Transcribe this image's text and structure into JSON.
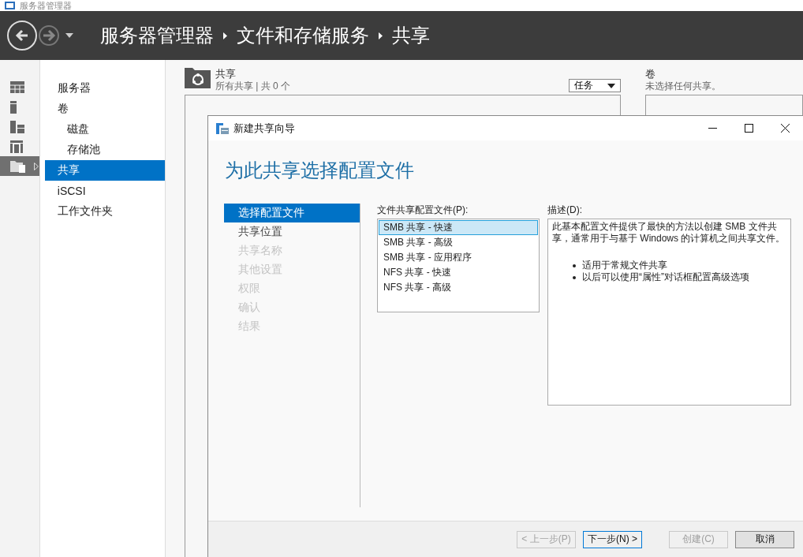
{
  "window": {
    "title": "服务器管理器"
  },
  "header": {
    "nav_buttons": [
      {
        "kind": "back",
        "disabled": false
      },
      {
        "kind": "forward",
        "disabled": true
      }
    ],
    "breadcrumb": [
      "服务器管理器",
      "文件和存储服务",
      "共享"
    ]
  },
  "rail": [
    {
      "selected": false
    },
    {
      "selected": false
    },
    {
      "selected": false
    },
    {
      "selected": false
    },
    {
      "selected": true
    }
  ],
  "sidebar": {
    "items": [
      {
        "label": "服务器",
        "selected": false
      },
      {
        "label": "卷",
        "selected": false,
        "children": [
          {
            "label": "磁盘",
            "selected": false
          },
          {
            "label": "存储池",
            "selected": false
          }
        ]
      },
      {
        "label": "共享",
        "selected": true
      },
      {
        "label": "iSCSI",
        "selected": false
      },
      {
        "label": "工作文件夹",
        "selected": false
      }
    ]
  },
  "shares_panel": {
    "title": "共享",
    "subtitle": "所有共享 | 共 0 个",
    "tasks_button": "任务"
  },
  "volumes_panel": {
    "title": "卷",
    "subtitle": "未选择任何共享。"
  },
  "dialog": {
    "title": "新建共享向导",
    "heading": "为此共享选择配置文件",
    "steps": [
      {
        "label": "选择配置文件",
        "selected": true,
        "disabled": false
      },
      {
        "label": "共享位置",
        "selected": false,
        "disabled": false
      },
      {
        "label": "共享名称",
        "selected": false,
        "disabled": true
      },
      {
        "label": "其他设置",
        "selected": false,
        "disabled": true
      },
      {
        "label": "权限",
        "selected": false,
        "disabled": true
      },
      {
        "label": "确认",
        "selected": false,
        "disabled": true
      },
      {
        "label": "结果",
        "selected": false,
        "disabled": true
      }
    ],
    "profile_list": {
      "label": "文件共享配置文件(P):",
      "items": [
        {
          "label": "SMB 共享 - 快速",
          "selected": true
        },
        {
          "label": "SMB 共享 - 高级",
          "selected": false
        },
        {
          "label": "SMB 共享 - 应用程序",
          "selected": false
        },
        {
          "label": "NFS 共享 - 快速",
          "selected": false
        },
        {
          "label": "NFS 共享 - 高级",
          "selected": false
        }
      ]
    },
    "description": {
      "label": "描述(D):",
      "text": "此基本配置文件提供了最快的方法以创建 SMB 文件共享，通常用于与基于 Windows 的计算机之间共享文件。",
      "bullets": [
        "适用于常规文件共享",
        "以后可以使用“属性”对话框配置高级选项"
      ]
    },
    "buttons": [
      {
        "label": "< 上一步(P)",
        "disabled": true,
        "focused": false
      },
      {
        "label": "下一步(N) >",
        "disabled": false,
        "focused": true
      },
      {
        "label": "创建(C)",
        "disabled": true,
        "focused": false
      },
      {
        "label": "取消",
        "disabled": false,
        "focused": false
      }
    ]
  }
}
